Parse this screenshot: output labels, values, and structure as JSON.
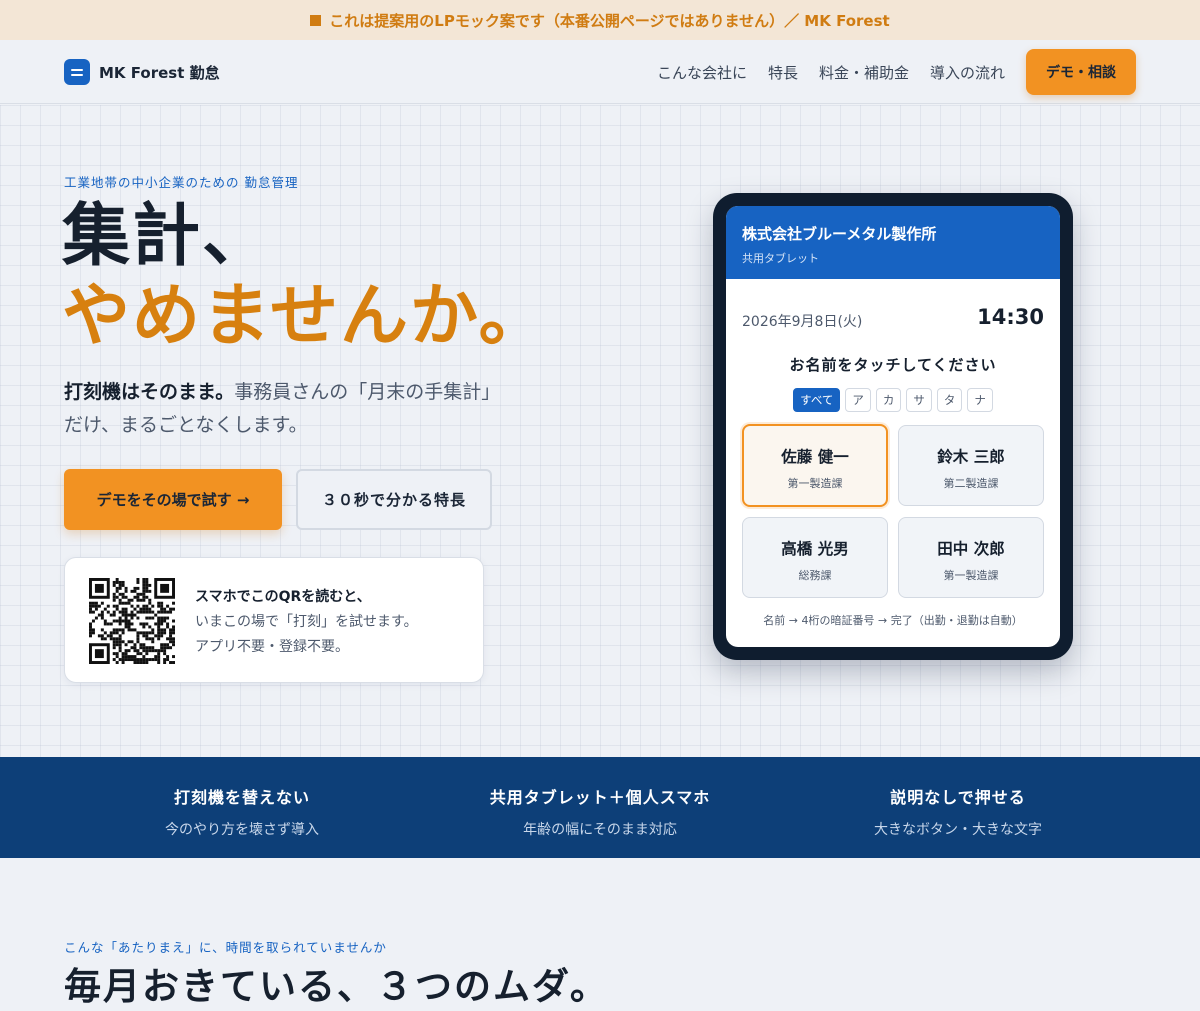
{
  "banner": {
    "text": "これは提案用のLPモック案です（本番公開ページではありません）／ MK Forest"
  },
  "header": {
    "logo_text": "MK Forest 勤怠",
    "nav": [
      "こんな会社に",
      "特長",
      "料金・補助金",
      "導入の流れ"
    ],
    "cta": "デモ・相談"
  },
  "hero": {
    "eyebrow": "工業地帯の中小企業のための 勤怠管理",
    "headline_1": "集計、",
    "headline_2": "やめませんか。",
    "lead_bold": "打刻機はそのまま。",
    "lead_rest": "事務員さんの「月末の手集計」だけ、まるごとなくします。",
    "primary_button": "デモをその場で試す →",
    "secondary_button": "３０秒で分かる特長",
    "qr_card": {
      "line1": "スマホでこのQRを読むと、",
      "line2": "いまこの場で「打刻」を試せます。",
      "line3": "アプリ不要・登録不要。"
    }
  },
  "tablet": {
    "company": "株式会社ブルーメタル製作所",
    "subtitle": "共用タブレット",
    "date": "2026年9月8日(火)",
    "time": "14:30",
    "prompt": "お名前をタッチしてください",
    "tabs": [
      "すべて",
      "ア",
      "カ",
      "サ",
      "タ",
      "ナ"
    ],
    "active_tab": "すべて",
    "employees": [
      {
        "name": "佐藤 健一",
        "dept": "第一製造課",
        "selected": true
      },
      {
        "name": "鈴木 三郎",
        "dept": "第二製造課",
        "selected": false
      },
      {
        "name": "高橋 光男",
        "dept": "総務課",
        "selected": false
      },
      {
        "name": "田中 次郎",
        "dept": "第一製造課",
        "selected": false
      }
    ],
    "footer": "名前 → 4桁の暗証番号 → 完了（出勤・退勤は自動）"
  },
  "features": [
    {
      "title": "打刻機を替えない",
      "sub": "今のやり方を壊さず導入"
    },
    {
      "title": "共用タブレット＋個人スマホ",
      "sub": "年齢の幅にそのまま対応"
    },
    {
      "title": "説明なしで押せる",
      "sub": "大きなボタン・大きな文字"
    }
  ],
  "section": {
    "eyebrow": "こんな「あたりまえ」に、時間を取られていませんか",
    "title": "毎月おきている、３つのムダ。"
  },
  "colors": {
    "accent_orange": "#f29222",
    "brand_blue": "#1763c2",
    "strip_navy": "#0d3f78"
  }
}
